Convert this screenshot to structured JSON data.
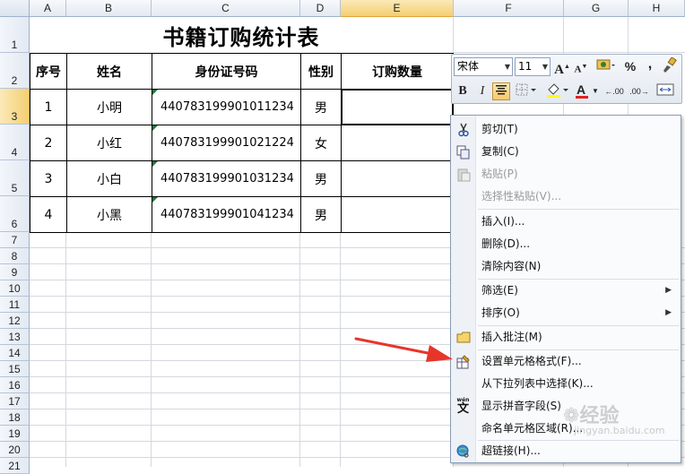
{
  "columns": [
    "A",
    "B",
    "C",
    "D",
    "E",
    "F",
    "G",
    "H"
  ],
  "rows": [
    "1",
    "2",
    "3",
    "4",
    "5",
    "6",
    "7",
    "8",
    "9",
    "10",
    "11",
    "12",
    "13",
    "14",
    "15",
    "16",
    "17",
    "18",
    "19",
    "20",
    "21"
  ],
  "sheet": {
    "title": "书籍订购统计表",
    "headers": [
      "序号",
      "姓名",
      "身份证号码",
      "性别",
      "订购数量"
    ],
    "records": [
      {
        "no": "1",
        "name": "小明",
        "id": "440783199901011234",
        "gender": "男"
      },
      {
        "no": "2",
        "name": "小红",
        "id": "440783199901021224",
        "gender": "女"
      },
      {
        "no": "3",
        "name": "小白",
        "id": "440783199901031234",
        "gender": "男"
      },
      {
        "no": "4",
        "name": "小黑",
        "id": "440783199901041234",
        "gender": "男"
      }
    ]
  },
  "mini_toolbar": {
    "font_name": "宋体",
    "font_size": "11",
    "grow_font": "A",
    "shrink_font": "A",
    "percent": "%",
    "comma": ",",
    "bold": "B",
    "italic": "I",
    "font_color_letter": "A",
    "inc_decimal": ".00",
    "dec_decimal": ".00"
  },
  "context_menu": {
    "items": [
      {
        "label": "剪切(T)",
        "icon": "scissors-icon",
        "disabled": false
      },
      {
        "label": "复制(C)",
        "icon": "copy-icon",
        "disabled": false
      },
      {
        "label": "粘贴(P)",
        "icon": "paste-icon",
        "disabled": true
      },
      {
        "label": "选择性粘贴(V)...",
        "icon": "",
        "disabled": true
      },
      {
        "label": "插入(I)...",
        "icon": "",
        "disabled": false
      },
      {
        "label": "删除(D)...",
        "icon": "",
        "disabled": false
      },
      {
        "label": "清除内容(N)",
        "icon": "",
        "disabled": false
      },
      {
        "label": "筛选(E)",
        "icon": "",
        "disabled": false,
        "submenu": true
      },
      {
        "label": "排序(O)",
        "icon": "",
        "disabled": false,
        "submenu": true
      },
      {
        "label": "插入批注(M)",
        "icon": "comment-icon",
        "disabled": false
      },
      {
        "label": "设置单元格格式(F)...",
        "icon": "format-cells-icon",
        "disabled": false
      },
      {
        "label": "从下拉列表中选择(K)...",
        "icon": "",
        "disabled": false
      },
      {
        "label": "显示拼音字段(S)",
        "icon": "phonetic-icon",
        "disabled": false
      },
      {
        "label": "命名单元格区域(R)...",
        "icon": "",
        "disabled": false
      },
      {
        "label": "超链接(H)...",
        "icon": "hyperlink-icon",
        "disabled": false
      }
    ]
  },
  "watermark": {
    "text": "经验",
    "sub": "jingyan.baidu.com"
  },
  "colors": {
    "accent_selection": "#f3cf73",
    "arrow": "#e8352b",
    "triangle": "#1b7a3a"
  }
}
